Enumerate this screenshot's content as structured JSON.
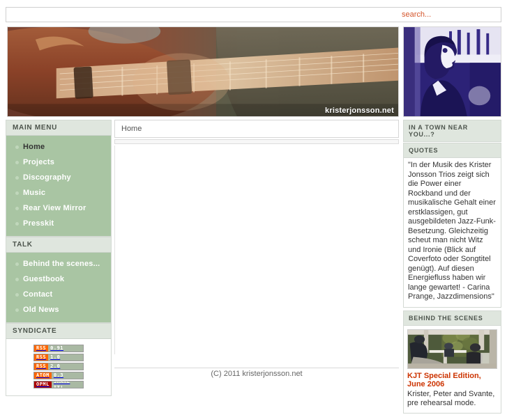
{
  "site": {
    "name": "kristerjonsson.net",
    "banner_caption": "kristerjonsson.net"
  },
  "search": {
    "placeholder": "search...",
    "value": ""
  },
  "breadcrumb": {
    "current": "Home"
  },
  "sidebar": {
    "main_menu": {
      "title": "MAIN MENU",
      "items": [
        {
          "label": "Home",
          "active": true
        },
        {
          "label": "Projects",
          "active": false
        },
        {
          "label": "Discography",
          "active": false
        },
        {
          "label": "Music",
          "active": false
        },
        {
          "label": "Rear View Mirror",
          "active": false
        },
        {
          "label": "Presskit",
          "active": false
        }
      ]
    },
    "talk": {
      "title": "TALK",
      "items": [
        {
          "label": "Behind the scenes...",
          "active": false
        },
        {
          "label": "Guestbook",
          "active": false
        },
        {
          "label": "Contact",
          "active": false
        },
        {
          "label": "Old News",
          "active": false
        }
      ]
    },
    "syndicate": {
      "title": "SYNDICATE",
      "badges": [
        {
          "label": "RSS",
          "value": "0.91",
          "kind": "rss"
        },
        {
          "label": "RSS",
          "value": "1.0",
          "kind": "rss"
        },
        {
          "label": "RSS",
          "value": "2.0",
          "kind": "rss"
        },
        {
          "label": "ATOM",
          "value": "0.3",
          "kind": "rss"
        },
        {
          "label": "OPML",
          "value": "SHARE IT!",
          "kind": "opml"
        }
      ]
    }
  },
  "right_sidebar": {
    "town_header": "IN A TOWN NEAR YOU...?",
    "quotes": {
      "title": "QUOTES",
      "text": "\"In der Musik des Krister Jonsson Trios zeigt sich die Power einer Rockband und der musikalische Gehalt einer erstklassigen, gut ausgebildeten Jazz-Funk-Besetzung. Gleichzeitig scheut man nicht Witz und Ironie (Blick auf Coverfoto oder Songtitel genügt). Auf diesen Energiefluss haben wir lange gewartet! - Carina Prange, Jazzdimensions\""
    },
    "behind_the_scenes": {
      "title": "BEHIND THE SCENES",
      "entry_title": "KJT Special Edition, June 2006",
      "entry_text": "Krister, Peter and Svante, pre rehearsal mode."
    }
  },
  "footer": {
    "copyright": "(C) 2011 kristerjonsson.net"
  },
  "colors": {
    "menu_green": "#a9c5a3",
    "panel_header": "#dfe6de",
    "accent_orange": "#d4552b",
    "link_red": "#cc3300",
    "rss_orange": "#ff6600",
    "opml_red": "#aa0000"
  }
}
